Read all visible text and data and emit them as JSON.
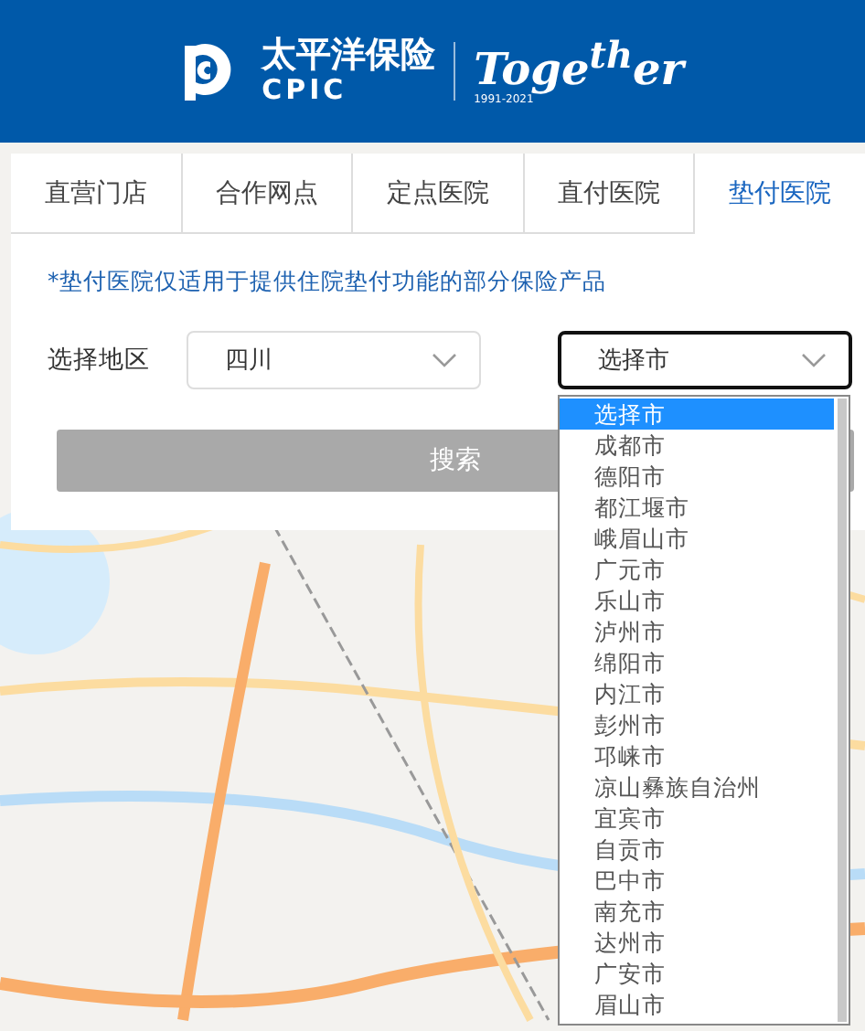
{
  "header": {
    "brand_cn": "太平洋保险",
    "brand_en": "CPIC",
    "anniversary": "Toge$^{th}$er",
    "years": "1991-2021"
  },
  "tabs": [
    {
      "label": "直营门店",
      "selected": false
    },
    {
      "label": "合作网点",
      "selected": false
    },
    {
      "label": "定点医院",
      "selected": false
    },
    {
      "label": "直付医院",
      "selected": false
    },
    {
      "label": "垫付医院",
      "selected": true
    }
  ],
  "notice": "*垫付医院仅适用于提供住院垫付功能的部分保险产品",
  "region": {
    "label": "选择地区",
    "province": {
      "value": "四川",
      "focused": false
    },
    "city": {
      "value": "选择市",
      "focused": true,
      "open": true
    }
  },
  "city_options": [
    {
      "label": "选择市",
      "selected": true
    },
    {
      "label": "成都市",
      "selected": false
    },
    {
      "label": "德阳市",
      "selected": false
    },
    {
      "label": "都江堰市",
      "selected": false
    },
    {
      "label": "峨眉山市",
      "selected": false
    },
    {
      "label": "广元市",
      "selected": false
    },
    {
      "label": "乐山市",
      "selected": false
    },
    {
      "label": "泸州市",
      "selected": false
    },
    {
      "label": "绵阳市",
      "selected": false
    },
    {
      "label": "内江市",
      "selected": false
    },
    {
      "label": "彭州市",
      "selected": false
    },
    {
      "label": "邛崃市",
      "selected": false
    },
    {
      "label": "凉山彝族自治州",
      "selected": false
    },
    {
      "label": "宜宾市",
      "selected": false
    },
    {
      "label": "自贡市",
      "selected": false
    },
    {
      "label": "巴中市",
      "selected": false
    },
    {
      "label": "南充市",
      "selected": false
    },
    {
      "label": "达州市",
      "selected": false
    },
    {
      "label": "广安市",
      "selected": false
    },
    {
      "label": "眉山市",
      "selected": false
    }
  ],
  "search_button": {
    "label": "搜索",
    "disabled": true
  }
}
